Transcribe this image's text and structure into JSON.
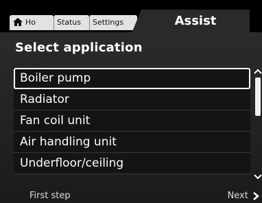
{
  "tabs": {
    "home_label": "Ho",
    "status_label": "Status",
    "settings_label": "Settings",
    "active_label": "Assist"
  },
  "page_title": "Select application",
  "list": {
    "items": [
      {
        "label": "Boiler pump",
        "selected": true
      },
      {
        "label": "Radiator",
        "selected": false
      },
      {
        "label": "Fan coil unit",
        "selected": false
      },
      {
        "label": "Air handling unit",
        "selected": false
      },
      {
        "label": "Underfloor/ceiling",
        "selected": false
      }
    ]
  },
  "footer": {
    "first_step_label": "First step",
    "next_label": "Next"
  },
  "icons": {
    "home": "home-icon",
    "scroll_up": "chevron-up-icon",
    "scroll_down": "chevron-down-icon",
    "next": "chevron-right-icon"
  },
  "colors": {
    "background": "#000000",
    "panel": "#222222",
    "tab_inactive": "#e2e2e2",
    "selection_border": "#ffffff"
  }
}
